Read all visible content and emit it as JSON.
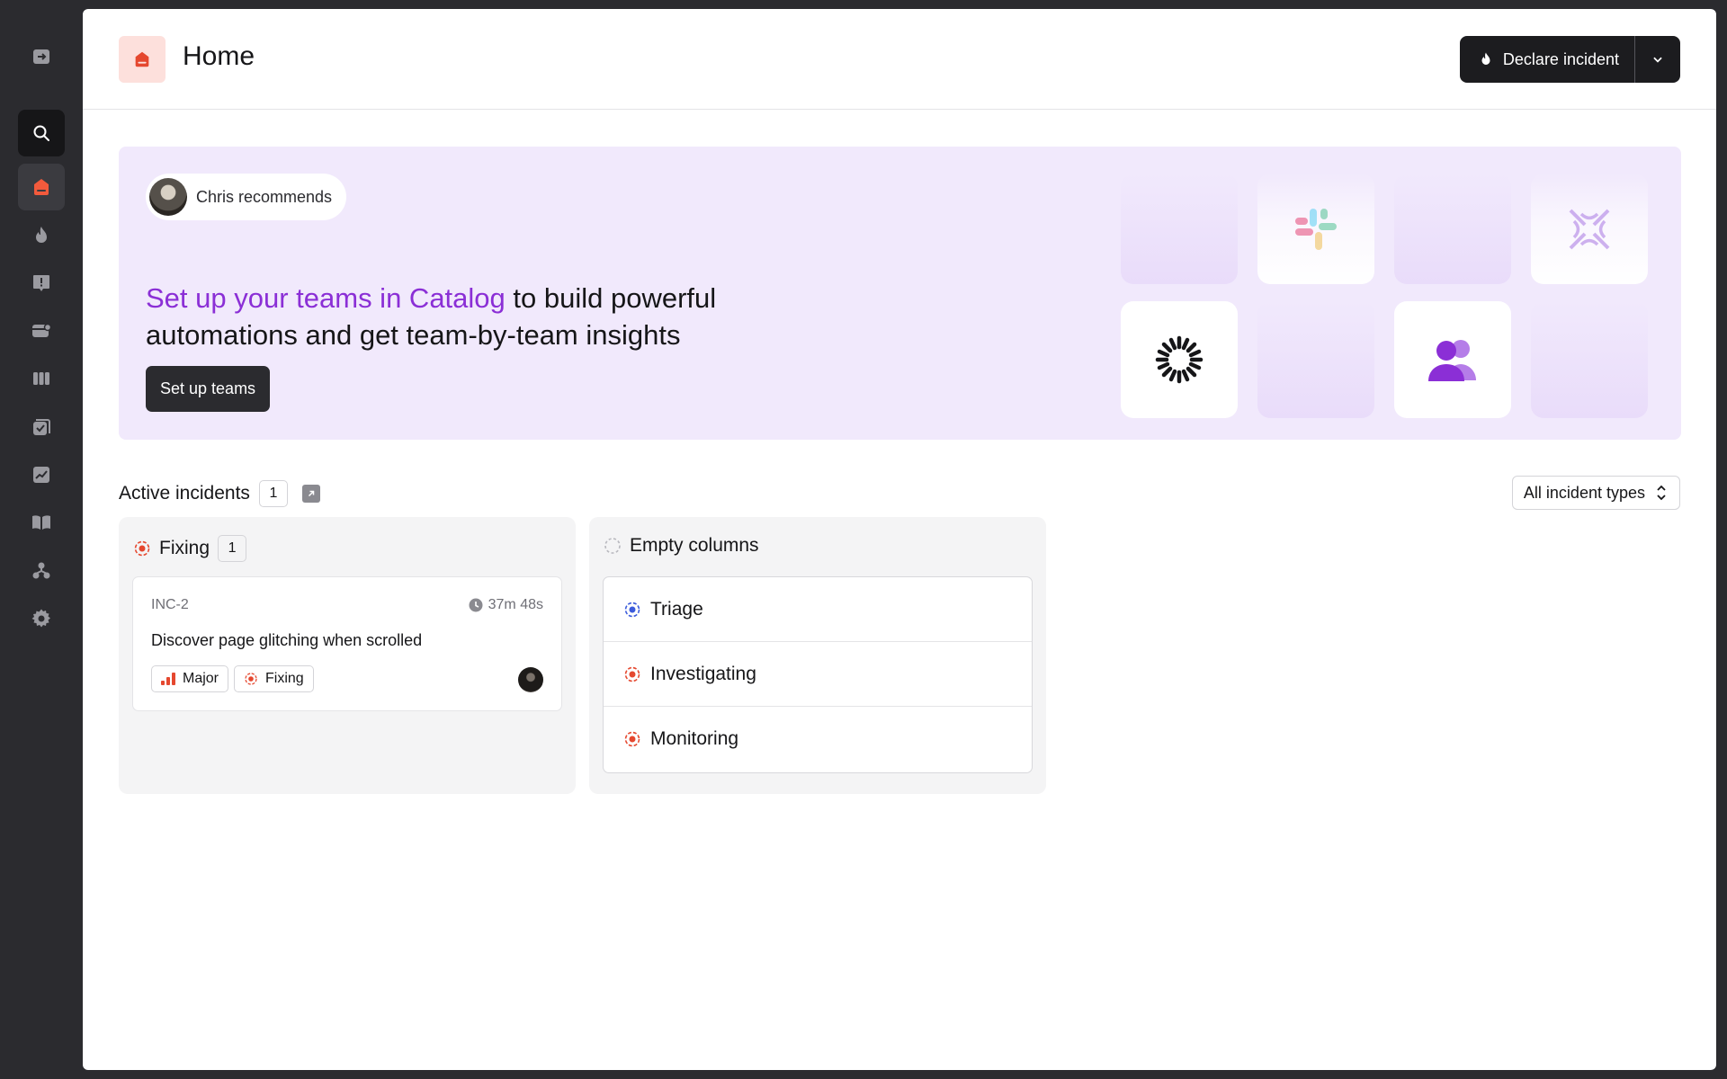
{
  "sidebar": {
    "items": [
      {
        "name": "collapse-sidebar-icon"
      },
      {
        "name": "search-icon"
      },
      {
        "name": "home-icon"
      },
      {
        "name": "incidents-flame-icon"
      },
      {
        "name": "alerts-icon"
      },
      {
        "name": "on-call-icon"
      },
      {
        "name": "status-pages-icon"
      },
      {
        "name": "workflows-icon"
      },
      {
        "name": "insights-icon"
      },
      {
        "name": "catalog-book-icon"
      },
      {
        "name": "teams-org-icon"
      },
      {
        "name": "settings-gear-icon"
      }
    ]
  },
  "header": {
    "title": "Home",
    "declare_label": "Declare incident"
  },
  "banner": {
    "recommender": "Chris recommends",
    "headline_highlight": "Set up your teams in Catalog",
    "headline_rest": " to build powerful automations and get team-by-team insights",
    "cta_label": "Set up teams"
  },
  "active_incidents": {
    "title": "Active incidents",
    "count": "1",
    "filter_label": "All incident types",
    "columns": [
      {
        "title": "Fixing",
        "count": "1",
        "incidents": [
          {
            "id": "INC-2",
            "duration": "37m 48s",
            "name": "Discover page glitching when scrolled",
            "severity": "Major",
            "status": "Fixing"
          }
        ]
      },
      {
        "title": "Empty columns",
        "statuses": [
          "Triage",
          "Investigating",
          "Monitoring"
        ]
      }
    ]
  },
  "colors": {
    "accent_red": "#e5482f",
    "accent_purple": "#8b2fd6",
    "triage_blue": "#3b5bdb",
    "banner_bg": "#f1e9fc"
  }
}
